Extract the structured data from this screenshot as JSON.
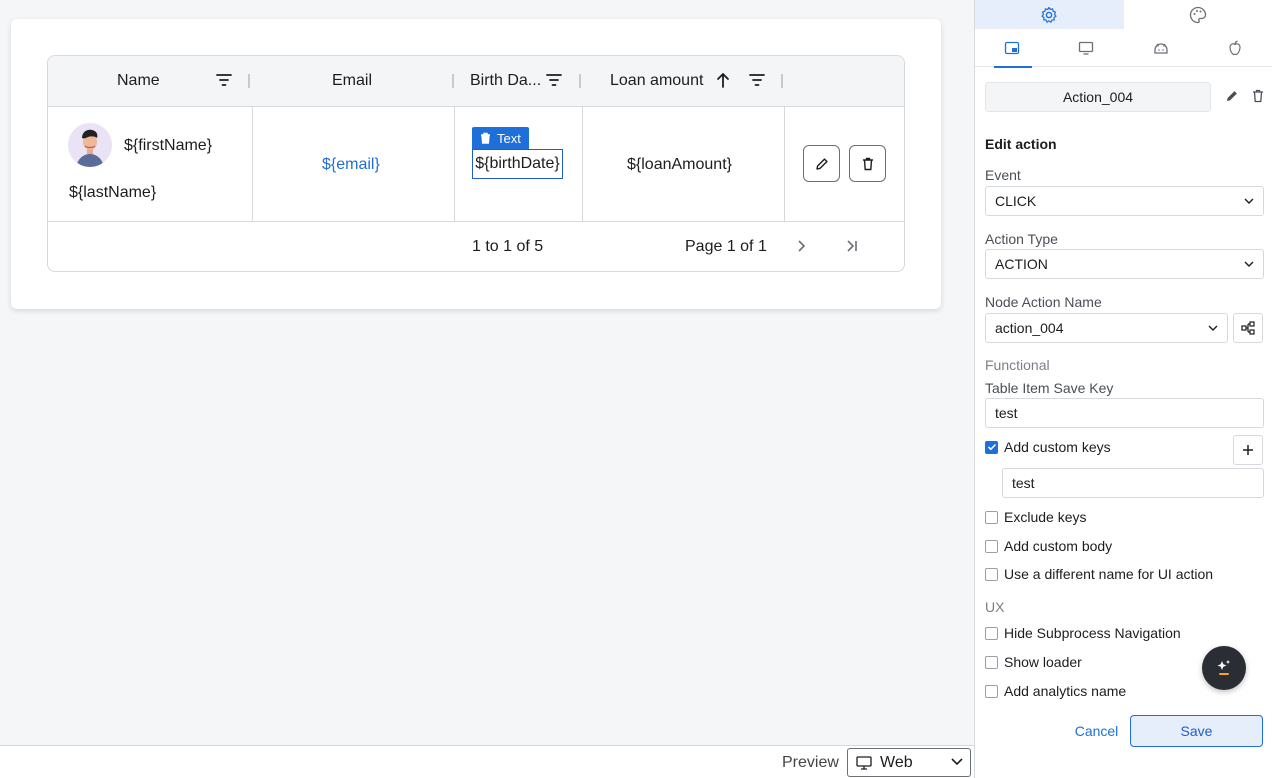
{
  "table": {
    "headers": {
      "name": "Name",
      "email": "Email",
      "birth_date": "Birth Da...",
      "loan_amount": "Loan amount"
    },
    "row": {
      "first_name": "${firstName}",
      "last_name": "${lastName}",
      "email": "${email}",
      "birth_date": "${birthDate}",
      "loan_amount": "${loanAmount}",
      "selected_tag": "Text"
    },
    "footer": {
      "range": "1 to 1 of 5",
      "page": "Page 1 of 1"
    }
  },
  "bottom_bar": {
    "preview_label": "Preview",
    "preview_value": "Web"
  },
  "panel": {
    "action_name": "Action_004",
    "edit_title": "Edit action",
    "event_label": "Event",
    "event_value": "CLICK",
    "action_type_label": "Action Type",
    "action_type_value": "ACTION",
    "node_action_label": "Node Action Name",
    "node_action_value": "action_004",
    "functional_label": "Functional",
    "save_key_label": "Table Item Save Key",
    "save_key_value": "test",
    "custom_keys_label": "Add custom keys",
    "custom_key_value": "test",
    "exclude_keys_label": "Exclude keys",
    "custom_body_label": "Add custom body",
    "diff_name_label": "Use a different name for UI action",
    "ux_label": "UX",
    "hide_subprocess_label": "Hide Subprocess Navigation",
    "show_loader_label": "Show loader",
    "analytics_label": "Add analytics name",
    "cancel_label": "Cancel",
    "save_label": "Save"
  },
  "colors": {
    "accent": "#1e6fd9",
    "active_tab_bg": "#e6eefc"
  }
}
